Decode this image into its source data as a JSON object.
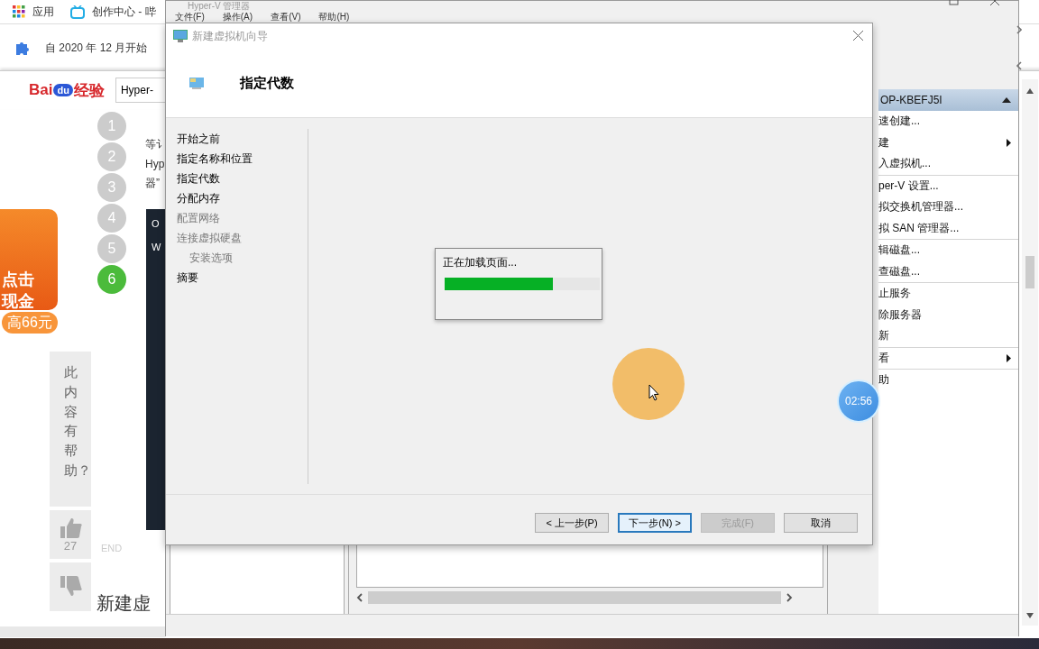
{
  "browser": {
    "bookmarks": [
      {
        "label": "应用"
      },
      {
        "label": "创作中心 - 哔"
      }
    ],
    "notice": "自 2020 年 12 月开始",
    "logo": {
      "left": "Bai",
      "badge": "du",
      "right": "经验"
    },
    "search": {
      "value": "Hyper-"
    }
  },
  "article": {
    "steps": [
      {
        "label": "1",
        "selected": false
      },
      {
        "label": "2",
        "selected": false
      },
      {
        "label": "3",
        "selected": false
      },
      {
        "label": "4",
        "selected": false
      },
      {
        "label": "5",
        "selected": false
      },
      {
        "label": "6",
        "selected": true
      }
    ],
    "lines": [
      "等讠",
      "Hyp",
      "器”"
    ],
    "screenshot_letters": [
      "O",
      "W"
    ],
    "end": "END",
    "heading": "新建虚"
  },
  "ad": {
    "lines": [
      "点击",
      "现金",
      "高66元"
    ]
  },
  "feedback": {
    "question": "此内容有帮助？",
    "likes": "27"
  },
  "hyperv": {
    "title": "Hyper-V 管理器",
    "menu": [
      "文件(F)",
      "操作(A)",
      "查看(V)",
      "帮助(H)"
    ],
    "actions": {
      "header": "OP-KBEFJ5I",
      "expanded": true,
      "groups": [
        {
          "items": [
            {
              "label": "速创建...",
              "submenu": false
            },
            {
              "label": "建",
              "submenu": true
            },
            {
              "label": "入虚拟机...",
              "submenu": false
            }
          ]
        },
        {
          "items": [
            {
              "label": "per-V 设置...",
              "submenu": false
            },
            {
              "label": "拟交换机管理器...",
              "submenu": false
            },
            {
              "label": "拟 SAN 管理器...",
              "submenu": false
            }
          ]
        },
        {
          "items": [
            {
              "label": "辑磁盘...",
              "submenu": false
            },
            {
              "label": "查磁盘...",
              "submenu": false
            }
          ]
        },
        {
          "items": [
            {
              "label": "止服务",
              "submenu": false
            },
            {
              "label": "除服务器",
              "submenu": false
            },
            {
              "label": "新",
              "submenu": false
            }
          ]
        },
        {
          "items": [
            {
              "label": "看",
              "submenu": true
            }
          ]
        },
        {
          "items": [
            {
              "label": "助",
              "submenu": false
            }
          ]
        }
      ]
    }
  },
  "dialog": {
    "title": "新建虚拟机向导",
    "heading": "指定代数",
    "steps": [
      {
        "label": "开始之前",
        "disabled": false
      },
      {
        "label": "指定名称和位置",
        "disabled": false
      },
      {
        "label": "指定代数",
        "disabled": false
      },
      {
        "label": "分配内存",
        "disabled": false
      },
      {
        "label": "配置网络",
        "disabled": true
      },
      {
        "label": "连接虚拟硬盘",
        "disabled": true,
        "children": [
          {
            "label": "安装选项",
            "disabled": true
          }
        ]
      },
      {
        "label": "摘要",
        "disabled": false
      }
    ],
    "loading": {
      "text": "正在加载页面...",
      "level": 0.7
    },
    "buttons": [
      {
        "label": "< 上一步(P)",
        "default": false,
        "disabled": false
      },
      {
        "label": "下一步(N) >",
        "default": true,
        "disabled": false
      },
      {
        "label": "完成(F)",
        "default": false,
        "disabled": true
      },
      {
        "label": "取消",
        "default": false,
        "disabled": false
      }
    ]
  },
  "recorder": {
    "timer": "02:56"
  }
}
